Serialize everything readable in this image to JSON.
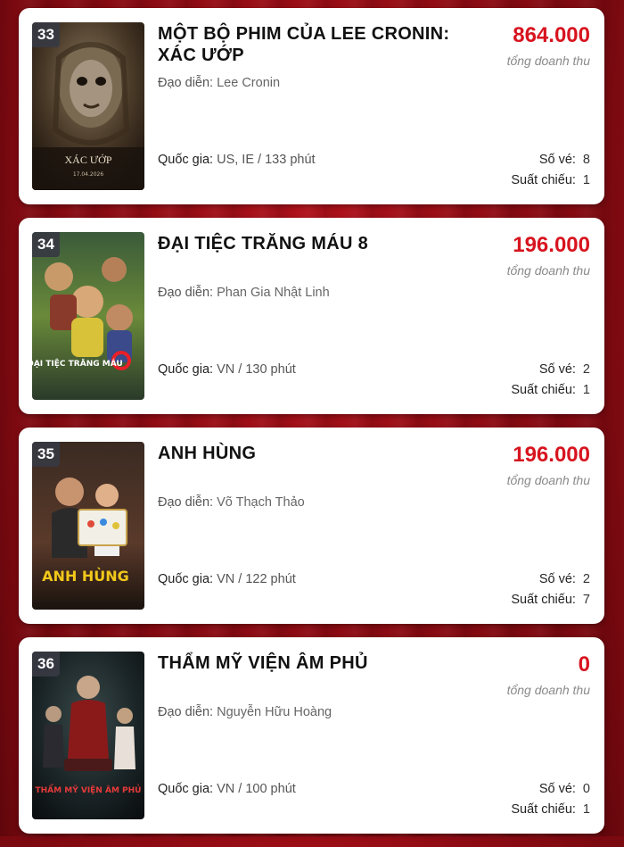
{
  "labels": {
    "director": "Đạo diễn:",
    "country": "Quốc gia:",
    "revenue_label": "tổng doanh thu",
    "tickets": "Số vé:",
    "shows": "Suất chiếu:"
  },
  "colors": {
    "background": "#9a0d15",
    "card": "#ffffff",
    "revenue": "#d7141f",
    "rank_badge": "#373a42"
  },
  "movies": [
    {
      "rank": "33",
      "title": "MỘT BỘ PHIM CỦA LEE CRONIN: XÁC ƯỚP",
      "director": "Lee Cronin",
      "country_runtime": "US, IE / 133 phút",
      "revenue": "864.000",
      "tickets": "8",
      "shows": "1",
      "poster_caption": "XÁC ƯỚP",
      "poster_date": "17.04.2026"
    },
    {
      "rank": "34",
      "title": "ĐẠI TIỆC TRĂNG MÁU 8",
      "director": "Phan Gia Nhật Linh",
      "country_runtime": "VN / 130 phút",
      "revenue": "196.000",
      "tickets": "2",
      "shows": "1",
      "poster_caption": "ĐẠI TIỆC TRĂNG MÁU"
    },
    {
      "rank": "35",
      "title": "ANH HÙNG",
      "director": "Võ Thạch Thảo",
      "country_runtime": "VN / 122 phút",
      "revenue": "196.000",
      "tickets": "2",
      "shows": "7",
      "poster_caption": "ANH HÙNG"
    },
    {
      "rank": "36",
      "title": "THẨM MỸ VIỆN ÂM PHỦ",
      "director": "Nguyễn Hữu Hoàng",
      "country_runtime": "VN / 100 phút",
      "revenue": "0",
      "tickets": "0",
      "shows": "1",
      "poster_caption": "THẨM MỸ VIỆN ÂM PHỦ"
    }
  ]
}
